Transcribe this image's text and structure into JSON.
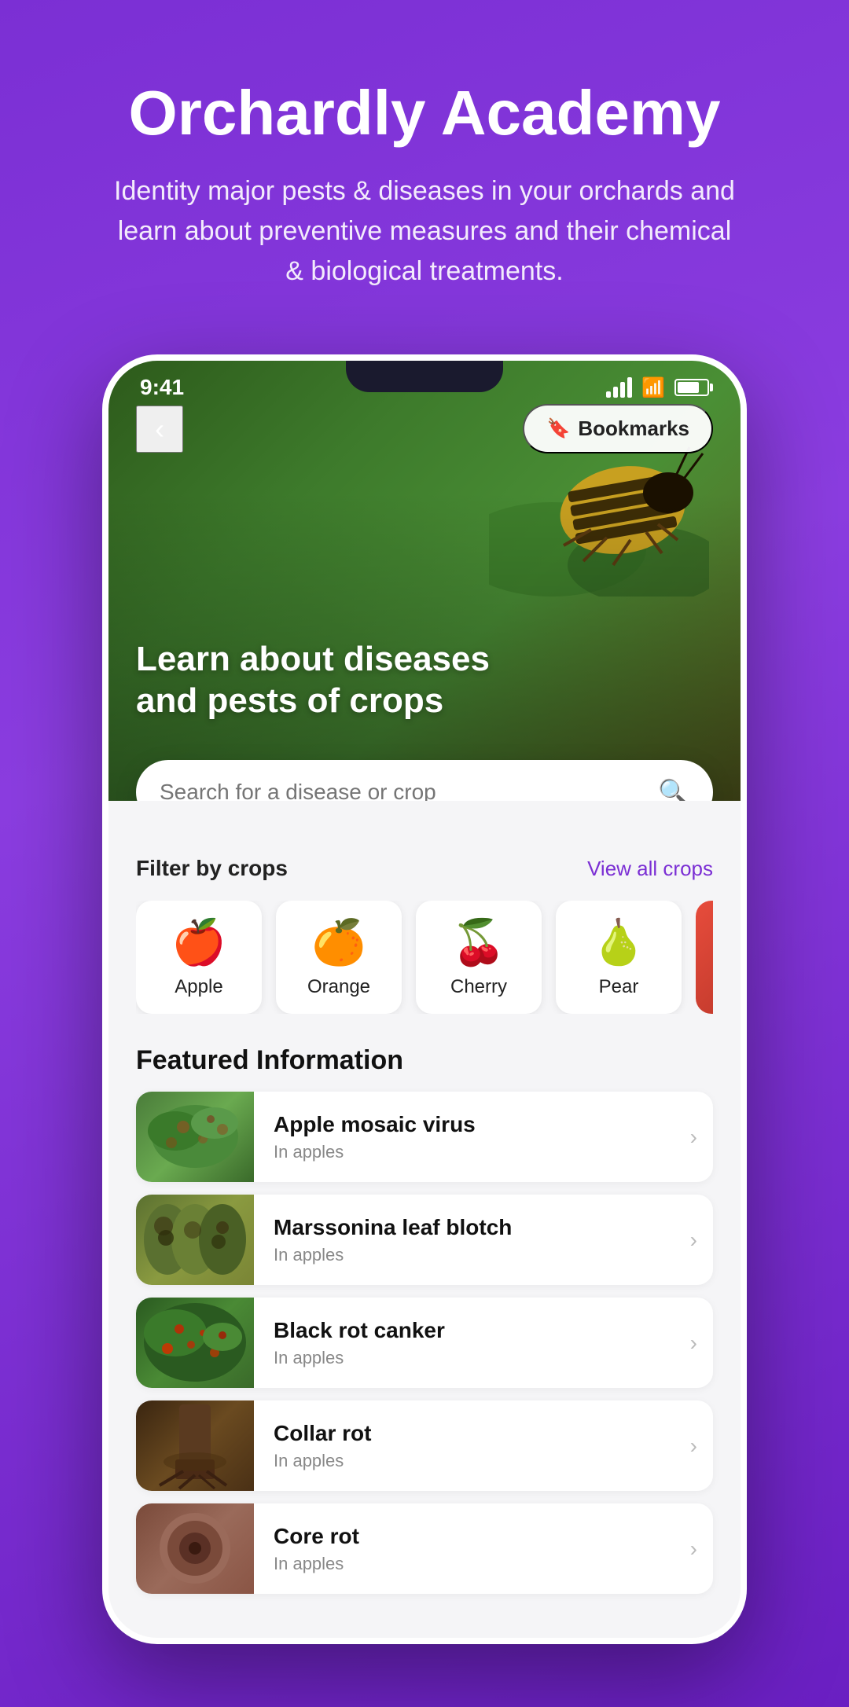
{
  "page": {
    "title": "Orchardly Academy",
    "subtitle": "Identity major pests & diseases in your orchards and learn about preventive measures and their chemical & biological treatments."
  },
  "statusBar": {
    "time": "9:41"
  },
  "hero": {
    "title": "Learn about diseases\nand pests of crops",
    "bookmarks_label": "Bookmarks"
  },
  "search": {
    "placeholder": "Search for a disease or crop"
  },
  "filter": {
    "label": "Filter by crops",
    "view_all": "View all crops"
  },
  "crops": [
    {
      "emoji": "🍎",
      "name": "Apple"
    },
    {
      "emoji": "🍊",
      "name": "Orange"
    },
    {
      "emoji": "🍒",
      "name": "Cherry"
    },
    {
      "emoji": "🍐",
      "name": "Pear"
    }
  ],
  "featured": {
    "label": "Featured Information",
    "items": [
      {
        "name": "Apple mosaic virus",
        "subtitle": "In apples"
      },
      {
        "name": "Marssonina leaf blotch",
        "subtitle": "In apples"
      },
      {
        "name": "Black rot canker",
        "subtitle": "In apples"
      },
      {
        "name": "Collar rot",
        "subtitle": "In apples"
      },
      {
        "name": "Core rot",
        "subtitle": "In apples"
      }
    ]
  }
}
